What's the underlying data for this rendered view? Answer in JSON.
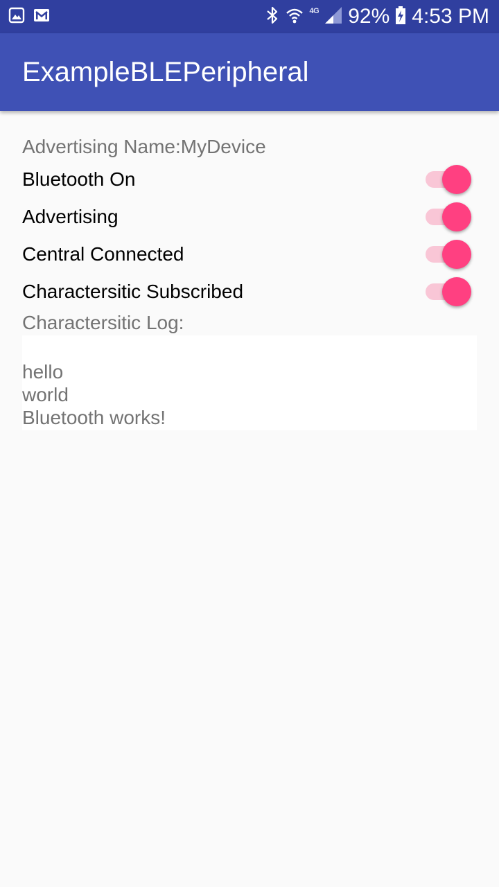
{
  "status_bar": {
    "left_icons": [
      "image-icon",
      "gmail-icon"
    ],
    "network_label": "4G",
    "battery": "92%",
    "time": "4:53 PM"
  },
  "app_bar": {
    "title": "ExampleBLEPeripheral"
  },
  "main": {
    "advertising_name": "Advertising Name:MyDevice",
    "toggles": [
      {
        "label": "Bluetooth On",
        "checked": true
      },
      {
        "label": "Advertising",
        "checked": true
      },
      {
        "label": "Central Connected",
        "checked": true
      },
      {
        "label": "Charactersitic Subscribed",
        "checked": true
      }
    ],
    "log_label": "Charactersitic Log:",
    "log_lines": [
      "hello",
      "world",
      "Bluetooth works!"
    ]
  },
  "colors": {
    "status_bar": "#303f9f",
    "primary": "#3f51b5",
    "accent": "#ff4081",
    "switch_track": "#f9c6d6",
    "secondary_text": "#737373"
  }
}
